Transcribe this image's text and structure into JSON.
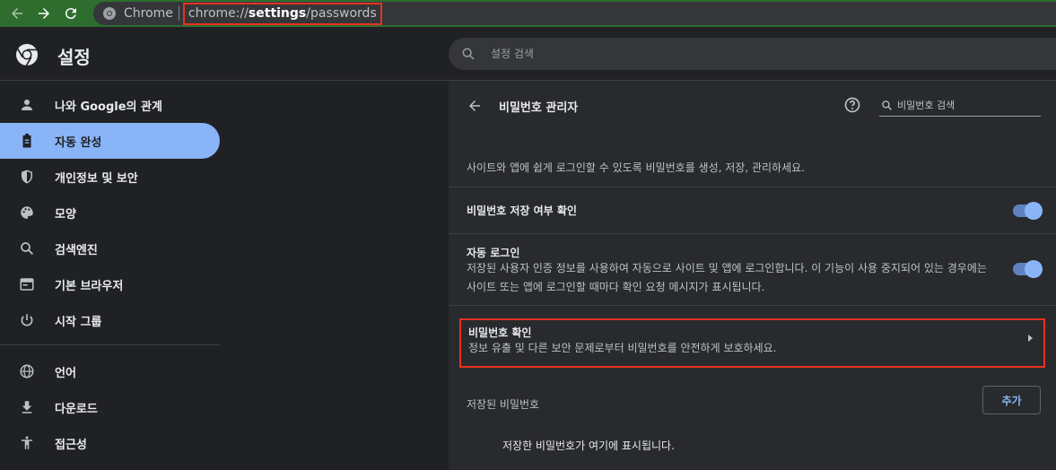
{
  "browser": {
    "site_chip": "Chrome",
    "url_prefix": "chrome://",
    "url_bold": "settings",
    "url_suffix": "/passwords"
  },
  "header": {
    "title": "설정",
    "search_placeholder": "설정 검색"
  },
  "sidebar": {
    "items": [
      {
        "label": "나와 Google의 관계",
        "icon": "person-icon"
      },
      {
        "label": "자동 완성",
        "icon": "clipboard-icon",
        "active": true
      },
      {
        "label": "개인정보 및 보안",
        "icon": "shield-icon"
      },
      {
        "label": "모양",
        "icon": "palette-icon"
      },
      {
        "label": "검색엔진",
        "icon": "search-icon"
      },
      {
        "label": "기본 브라우저",
        "icon": "browser-icon"
      },
      {
        "label": "시작 그룹",
        "icon": "power-icon"
      },
      {
        "label": "언어",
        "icon": "globe-icon"
      },
      {
        "label": "다운로드",
        "icon": "download-icon"
      },
      {
        "label": "접근성",
        "icon": "accessibility-icon"
      }
    ]
  },
  "main": {
    "title": "비밀번호 관리자",
    "search_placeholder": "비밀번호 검색",
    "description": "사이트와 앱에 쉽게 로그인할 수 있도록 비밀번호를 생성, 저장, 관리하세요.",
    "offer_save": {
      "title": "비밀번호 저장 여부 확인",
      "enabled": true
    },
    "auto_signin": {
      "title": "자동 로그인",
      "line1": "저장된 사용자 인증 정보를 사용하여 자동으로 사이트 및 앱에 로그인합니다. 이 기능이 사용 중지되어 있는 경우에는",
      "line2": "사이트 또는 앱에 로그인할 때마다 확인 요청 메시지가 표시됩니다.",
      "enabled": true
    },
    "password_check": {
      "title": "비밀번호 확인",
      "subtitle": "정보 유출 및 다른 보안 문제로부터 비밀번호를 안전하게 보호하세요."
    },
    "saved_label": "저장된 비밀번호",
    "add_button": "추가",
    "empty_message": "저장한 비밀번호가 여기에 표시됩니다."
  },
  "colors": {
    "accent": "#8ab4f8",
    "highlight": "#e8321e",
    "toolbar": "#2e6d2e"
  }
}
